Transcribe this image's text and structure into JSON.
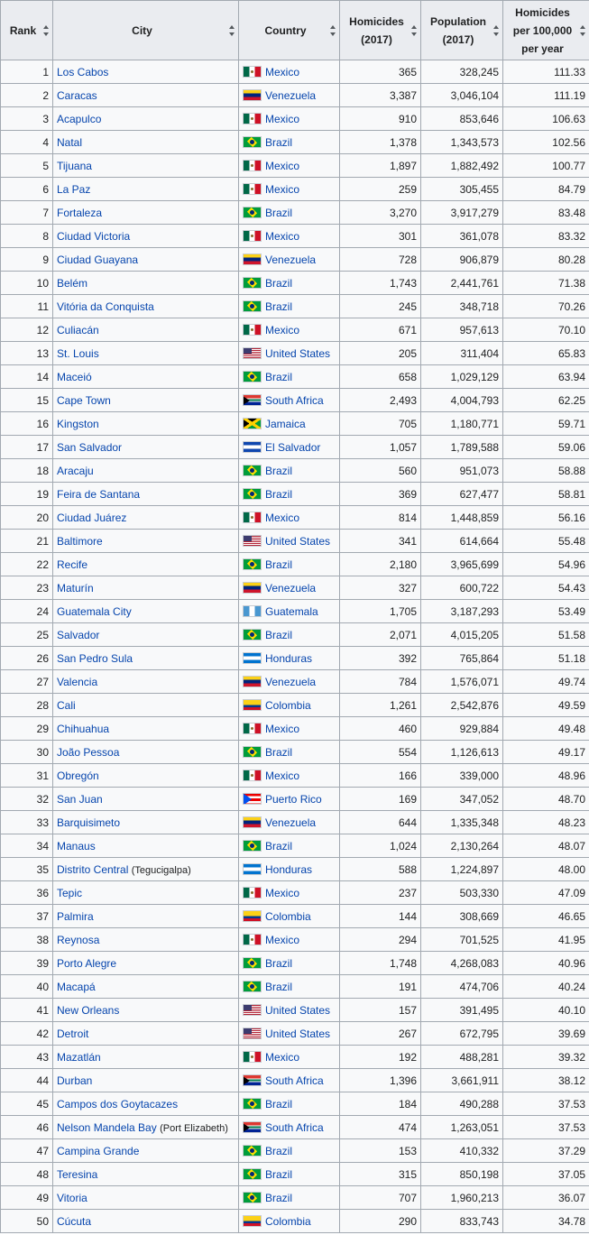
{
  "headers": {
    "rank": "Rank",
    "city": "City",
    "country": "Country",
    "homicides_line1": "Homicides",
    "homicides_line2": "(2017)",
    "population_line1": "Population",
    "population_line2": "(2017)",
    "rate_line1": "Homicides",
    "rate_line2": "per 100,000",
    "rate_line3": "per year"
  },
  "colors": {
    "link": "#0645ad",
    "header_bg": "#eaecf0",
    "border": "#a2a9b1",
    "cell_bg": "#f8f9fa"
  },
  "rows": [
    {
      "rank": "1",
      "city": "Los Cabos",
      "country": "Mexico",
      "flag": "mexico",
      "homicides": "365",
      "population": "328,245",
      "rate": "111.33"
    },
    {
      "rank": "2",
      "city": "Caracas",
      "country": "Venezuela",
      "flag": "venezuela",
      "homicides": "3,387",
      "population": "3,046,104",
      "rate": "111.19"
    },
    {
      "rank": "3",
      "city": "Acapulco",
      "country": "Mexico",
      "flag": "mexico",
      "homicides": "910",
      "population": "853,646",
      "rate": "106.63"
    },
    {
      "rank": "4",
      "city": "Natal",
      "country": "Brazil",
      "flag": "brazil",
      "homicides": "1,378",
      "population": "1,343,573",
      "rate": "102.56"
    },
    {
      "rank": "5",
      "city": "Tijuana",
      "country": "Mexico",
      "flag": "mexico",
      "homicides": "1,897",
      "population": "1,882,492",
      "rate": "100.77"
    },
    {
      "rank": "6",
      "city": "La Paz",
      "country": "Mexico",
      "flag": "mexico",
      "homicides": "259",
      "population": "305,455",
      "rate": "84.79"
    },
    {
      "rank": "7",
      "city": "Fortaleza",
      "country": "Brazil",
      "flag": "brazil",
      "homicides": "3,270",
      "population": "3,917,279",
      "rate": "83.48"
    },
    {
      "rank": "8",
      "city": "Ciudad Victoria",
      "country": "Mexico",
      "flag": "mexico",
      "homicides": "301",
      "population": "361,078",
      "rate": "83.32"
    },
    {
      "rank": "9",
      "city": "Ciudad Guayana",
      "country": "Venezuela",
      "flag": "venezuela",
      "homicides": "728",
      "population": "906,879",
      "rate": "80.28"
    },
    {
      "rank": "10",
      "city": "Belém",
      "country": "Brazil",
      "flag": "brazil",
      "homicides": "1,743",
      "population": "2,441,761",
      "rate": "71.38"
    },
    {
      "rank": "11",
      "city": "Vitória da Conquista",
      "country": "Brazil",
      "flag": "brazil",
      "homicides": "245",
      "population": "348,718",
      "rate": "70.26"
    },
    {
      "rank": "12",
      "city": "Culiacán",
      "country": "Mexico",
      "flag": "mexico",
      "homicides": "671",
      "population": "957,613",
      "rate": "70.10"
    },
    {
      "rank": "13",
      "city": "St. Louis",
      "country": "United States",
      "flag": "usa",
      "homicides": "205",
      "population": "311,404",
      "rate": "65.83"
    },
    {
      "rank": "14",
      "city": "Maceió",
      "country": "Brazil",
      "flag": "brazil",
      "homicides": "658",
      "population": "1,029,129",
      "rate": "63.94"
    },
    {
      "rank": "15",
      "city": "Cape Town",
      "country": "South Africa",
      "flag": "south-africa",
      "homicides": "2,493",
      "population": "4,004,793",
      "rate": "62.25"
    },
    {
      "rank": "16",
      "city": "Kingston",
      "country": "Jamaica",
      "flag": "jamaica",
      "homicides": "705",
      "population": "1,180,771",
      "rate": "59.71"
    },
    {
      "rank": "17",
      "city": "San Salvador",
      "country": "El Salvador",
      "flag": "el-salvador",
      "homicides": "1,057",
      "population": "1,789,588",
      "rate": "59.06"
    },
    {
      "rank": "18",
      "city": "Aracaju",
      "country": "Brazil",
      "flag": "brazil",
      "homicides": "560",
      "population": "951,073",
      "rate": "58.88"
    },
    {
      "rank": "19",
      "city": "Feira de Santana",
      "country": "Brazil",
      "flag": "brazil",
      "homicides": "369",
      "population": "627,477",
      "rate": "58.81"
    },
    {
      "rank": "20",
      "city": "Ciudad Juárez",
      "country": "Mexico",
      "flag": "mexico",
      "homicides": "814",
      "population": "1,448,859",
      "rate": "56.16"
    },
    {
      "rank": "21",
      "city": "Baltimore",
      "country": "United States",
      "flag": "usa",
      "homicides": "341",
      "population": "614,664",
      "rate": "55.48"
    },
    {
      "rank": "22",
      "city": "Recife",
      "country": "Brazil",
      "flag": "brazil",
      "homicides": "2,180",
      "population": "3,965,699",
      "rate": "54.96"
    },
    {
      "rank": "23",
      "city": "Maturín",
      "country": "Venezuela",
      "flag": "venezuela",
      "homicides": "327",
      "population": "600,722",
      "rate": "54.43"
    },
    {
      "rank": "24",
      "city": "Guatemala City",
      "country": "Guatemala",
      "flag": "guatemala",
      "homicides": "1,705",
      "population": "3,187,293",
      "rate": "53.49"
    },
    {
      "rank": "25",
      "city": "Salvador",
      "country": "Brazil",
      "flag": "brazil",
      "homicides": "2,071",
      "population": "4,015,205",
      "rate": "51.58"
    },
    {
      "rank": "26",
      "city": "San Pedro Sula",
      "country": "Honduras",
      "flag": "honduras",
      "homicides": "392",
      "population": "765,864",
      "rate": "51.18"
    },
    {
      "rank": "27",
      "city": "Valencia",
      "country": "Venezuela",
      "flag": "venezuela",
      "homicides": "784",
      "population": "1,576,071",
      "rate": "49.74"
    },
    {
      "rank": "28",
      "city": "Cali",
      "country": "Colombia",
      "flag": "colombia",
      "homicides": "1,261",
      "population": "2,542,876",
      "rate": "49.59"
    },
    {
      "rank": "29",
      "city": "Chihuahua",
      "country": "Mexico",
      "flag": "mexico",
      "homicides": "460",
      "population": "929,884",
      "rate": "49.48"
    },
    {
      "rank": "30",
      "city": "João Pessoa",
      "country": "Brazil",
      "flag": "brazil",
      "homicides": "554",
      "population": "1,126,613",
      "rate": "49.17"
    },
    {
      "rank": "31",
      "city": "Obregón",
      "country": "Mexico",
      "flag": "mexico",
      "homicides": "166",
      "population": "339,000",
      "rate": "48.96"
    },
    {
      "rank": "32",
      "city": "San Juan",
      "country": "Puerto Rico",
      "flag": "puerto-rico",
      "homicides": "169",
      "population": "347,052",
      "rate": "48.70"
    },
    {
      "rank": "33",
      "city": "Barquisimeto",
      "country": "Venezuela",
      "flag": "venezuela",
      "homicides": "644",
      "population": "1,335,348",
      "rate": "48.23"
    },
    {
      "rank": "34",
      "city": "Manaus",
      "country": "Brazil",
      "flag": "brazil",
      "homicides": "1,024",
      "population": "2,130,264",
      "rate": "48.07"
    },
    {
      "rank": "35",
      "city": "Distrito Central",
      "city_note": "(Tegucigalpa)",
      "country": "Honduras",
      "flag": "honduras",
      "homicides": "588",
      "population": "1,224,897",
      "rate": "48.00"
    },
    {
      "rank": "36",
      "city": "Tepic",
      "country": "Mexico",
      "flag": "mexico",
      "homicides": "237",
      "population": "503,330",
      "rate": "47.09"
    },
    {
      "rank": "37",
      "city": "Palmira",
      "country": "Colombia",
      "flag": "colombia",
      "homicides": "144",
      "population": "308,669",
      "rate": "46.65"
    },
    {
      "rank": "38",
      "city": "Reynosa",
      "country": "Mexico",
      "flag": "mexico",
      "homicides": "294",
      "population": "701,525",
      "rate": "41.95"
    },
    {
      "rank": "39",
      "city": "Porto Alegre",
      "country": "Brazil",
      "flag": "brazil",
      "homicides": "1,748",
      "population": "4,268,083",
      "rate": "40.96"
    },
    {
      "rank": "40",
      "city": "Macapá",
      "country": "Brazil",
      "flag": "brazil",
      "homicides": "191",
      "population": "474,706",
      "rate": "40.24"
    },
    {
      "rank": "41",
      "city": "New Orleans",
      "country": "United States",
      "flag": "usa",
      "homicides": "157",
      "population": "391,495",
      "rate": "40.10"
    },
    {
      "rank": "42",
      "city": "Detroit",
      "country": "United States",
      "flag": "usa",
      "homicides": "267",
      "population": "672,795",
      "rate": "39.69"
    },
    {
      "rank": "43",
      "city": "Mazatlán",
      "country": "Mexico",
      "flag": "mexico",
      "homicides": "192",
      "population": "488,281",
      "rate": "39.32"
    },
    {
      "rank": "44",
      "city": "Durban",
      "country": "South Africa",
      "flag": "south-africa",
      "homicides": "1,396",
      "population": "3,661,911",
      "rate": "38.12"
    },
    {
      "rank": "45",
      "city": "Campos dos Goytacazes",
      "country": "Brazil",
      "flag": "brazil",
      "homicides": "184",
      "population": "490,288",
      "rate": "37.53"
    },
    {
      "rank": "46",
      "city": "Nelson Mandela Bay",
      "city_note": "(Port Elizabeth)",
      "country": "South Africa",
      "flag": "south-africa",
      "homicides": "474",
      "population": "1,263,051",
      "rate": "37.53"
    },
    {
      "rank": "47",
      "city": "Campina Grande",
      "country": "Brazil",
      "flag": "brazil",
      "homicides": "153",
      "population": "410,332",
      "rate": "37.29"
    },
    {
      "rank": "48",
      "city": "Teresina",
      "country": "Brazil",
      "flag": "brazil",
      "homicides": "315",
      "population": "850,198",
      "rate": "37.05"
    },
    {
      "rank": "49",
      "city": "Vitoria",
      "country": "Brazil",
      "flag": "brazil",
      "homicides": "707",
      "population": "1,960,213",
      "rate": "36.07"
    },
    {
      "rank": "50",
      "city": "Cúcuta",
      "country": "Colombia",
      "flag": "colombia",
      "homicides": "290",
      "population": "833,743",
      "rate": "34.78"
    }
  ]
}
